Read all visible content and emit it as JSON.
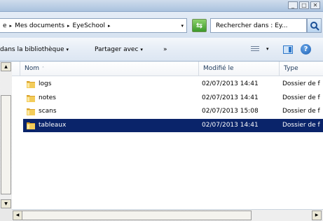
{
  "window": {
    "controls": [
      "_",
      "□",
      "✕"
    ]
  },
  "address": {
    "segments": [
      "e",
      "Mes documents",
      "EyeSchool"
    ],
    "separator": "▸",
    "dropdown": "▾"
  },
  "search": {
    "placeholder": "Rechercher dans : Ey..."
  },
  "toolbar": {
    "include_label": "dans la bibliothèque",
    "share_label": "Partager avec",
    "more": "»",
    "caret": "▾",
    "help": "?"
  },
  "columns": {
    "name": "Nom",
    "modified": "Modifié le",
    "type": "Type",
    "sort_indicator": "˄"
  },
  "files": [
    {
      "name": "logs",
      "modified": "02/07/2013 14:41",
      "type": "Dossier de f",
      "selected": false
    },
    {
      "name": "notes",
      "modified": "02/07/2013 14:41",
      "type": "Dossier de f",
      "selected": false
    },
    {
      "name": "scans",
      "modified": "02/07/2013 15:08",
      "type": "Dossier de f",
      "selected": false
    },
    {
      "name": "tableaux",
      "modified": "02/07/2013 14:41",
      "type": "Dossier de f",
      "selected": true
    }
  ],
  "colors": {
    "selection": "#0a246a",
    "folder": "#e8b83a"
  }
}
